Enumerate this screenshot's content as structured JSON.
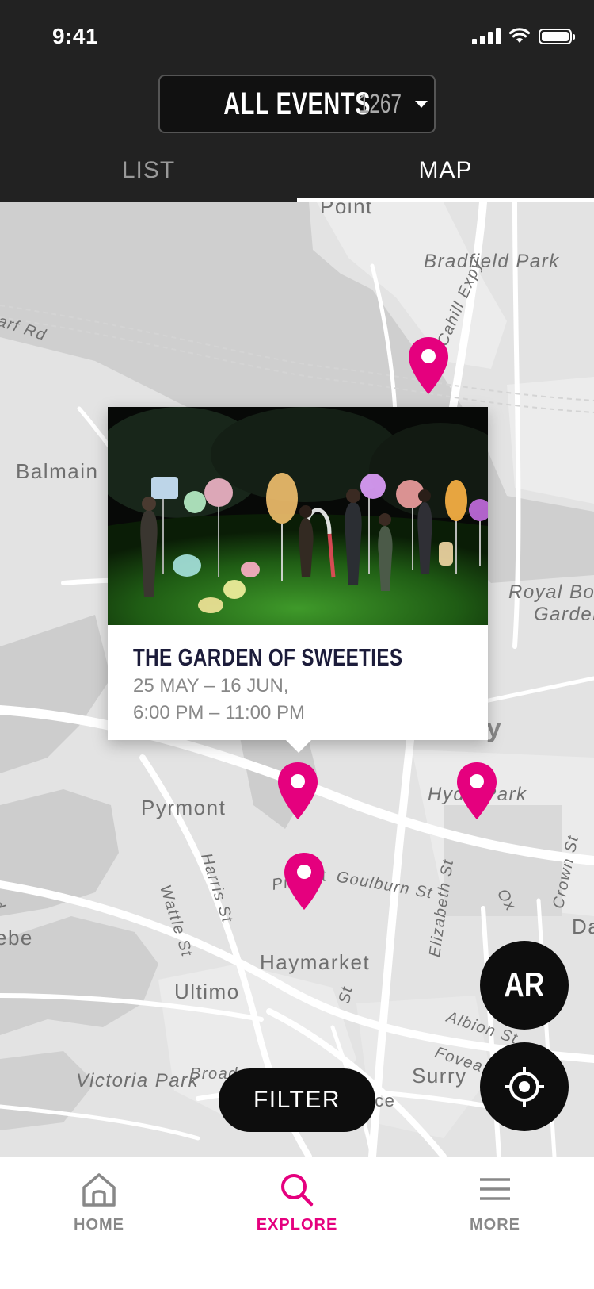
{
  "status_bar": {
    "time": "9:41"
  },
  "header": {
    "event_selector": {
      "label": "ALL EVENTS",
      "count": "1267"
    },
    "tabs": [
      {
        "label": "LIST",
        "active": false
      },
      {
        "label": "MAP",
        "active": true
      }
    ]
  },
  "map": {
    "labels": {
      "point": "Point",
      "bradfield_park": "Bradfield Park",
      "cahill_expy": "Cahill Expy",
      "arf_rd": "arf Rd",
      "balmain": "Balmain",
      "royal_bo": "Royal Bo",
      "garden": "Garden",
      "pyrmont": "Pyrmont",
      "hyde_park": "Hyde Park",
      "harris_st": "Harris St",
      "pier_st": "Pier St",
      "goulburn_st": "Goulburn St",
      "elizabeth_st": "Elizabeth St",
      "crown_st": "Crown St",
      "wattle_st": "Wattle St",
      "haymarket": "Haymarket",
      "ultimo": "Ultimo",
      "albion_st": "Albion St",
      "foveaux": "Fovea",
      "broad": "Broad",
      "victoria_park": "Victoria Park",
      "surry": "Surry",
      "prince": "Prince",
      "glebe": "ebe",
      "rd": "Rd",
      "da": "Da",
      "ox": "Ox",
      "y": "y",
      "st": "St"
    },
    "pin_color": "#e5007e"
  },
  "event_card": {
    "title": "THE GARDEN OF SWEETIES",
    "date_line": "25 MAY – 16 JUN,",
    "time_line": "6:00 PM – 11:00 PM"
  },
  "buttons": {
    "ar_label": "AR",
    "filter_label": "FILTER"
  },
  "bottom_nav": [
    {
      "label": "HOME",
      "icon": "home-icon",
      "active": false
    },
    {
      "label": "EXPLORE",
      "icon": "search-icon",
      "active": true
    },
    {
      "label": "MORE",
      "icon": "menu-icon",
      "active": false
    }
  ],
  "colors": {
    "accent": "#e5007e",
    "header_bg": "#222222",
    "title": "#1c1c3a"
  }
}
